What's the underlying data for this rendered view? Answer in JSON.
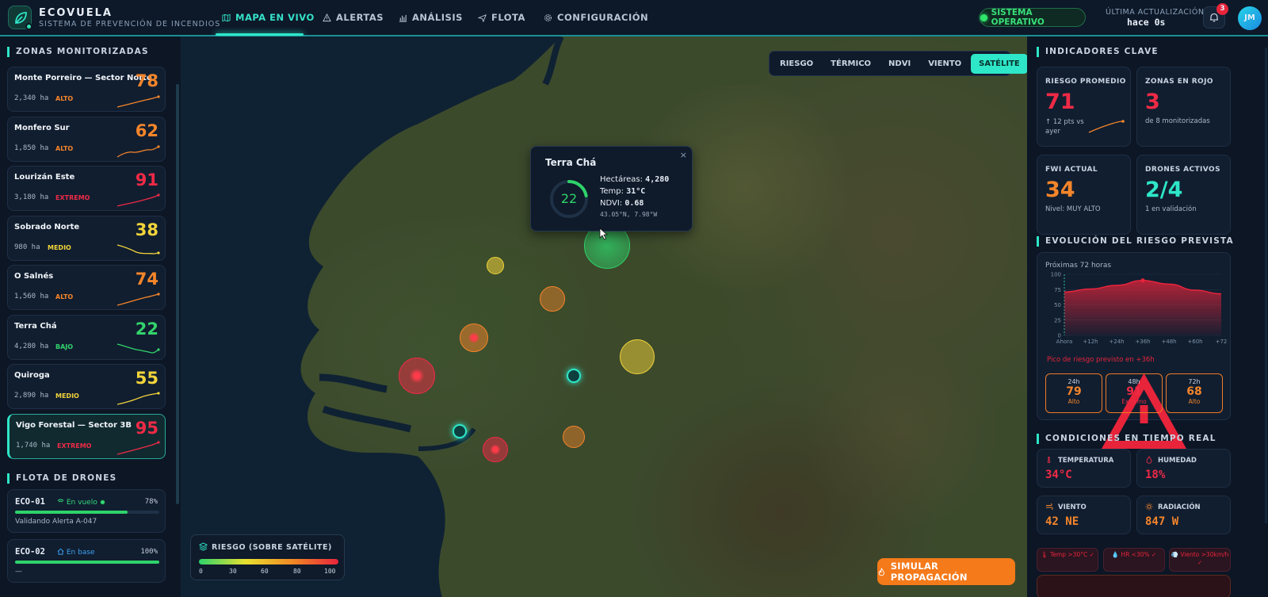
{
  "header": {
    "brand": "ECOVUELA",
    "brand_sub": "SISTEMA DE PREVENCIÓN DE INCENDIOS",
    "nav": [
      {
        "label": "MAPA EN VIVO",
        "icon": "map-icon",
        "active": true
      },
      {
        "label": "ALERTAS",
        "icon": "warning-icon",
        "active": false
      },
      {
        "label": "ANÁLISIS",
        "icon": "bar-chart-icon",
        "active": false
      },
      {
        "label": "FLOTA",
        "icon": "plane-icon",
        "active": false
      },
      {
        "label": "CONFIGURACIÓN",
        "icon": "gear-icon",
        "active": false
      }
    ],
    "status": "SISTEMA OPERATIVO",
    "update_label": "ÚLTIMA ACTUALIZACIÓN",
    "update_value": "hace 0s",
    "notifications": "3",
    "avatar": "JM"
  },
  "zones": {
    "title": "ZONAS MONITORIZADAS",
    "items": [
      {
        "name": "Monte Porreiro — Sector Norte",
        "ha": "2,340 ha",
        "level": "ALTO",
        "score": "78",
        "color": "#f5852a"
      },
      {
        "name": "Monfero Sur",
        "ha": "1,850 ha",
        "level": "ALTO",
        "score": "62",
        "color": "#f5852a"
      },
      {
        "name": "Lourizán Este",
        "ha": "3,180 ha",
        "level": "EXTREMO",
        "score": "91",
        "color": "#ee2a46"
      },
      {
        "name": "Sobrado Norte",
        "ha": "980 ha",
        "level": "MEDIO",
        "score": "38",
        "color": "#f2d43a"
      },
      {
        "name": "O Salnés",
        "ha": "1,560 ha",
        "level": "ALTO",
        "score": "74",
        "color": "#f5852a"
      },
      {
        "name": "Terra Chá",
        "ha": "4,280 ha",
        "level": "BAJO",
        "score": "22",
        "color": "#33d36b"
      },
      {
        "name": "Quiroga",
        "ha": "2,890 ha",
        "level": "MEDIO",
        "score": "55",
        "color": "#f2d43a"
      },
      {
        "name": "Vigo Forestal — Sector 3B",
        "ha": "1,740 ha",
        "level": "EXTREMO",
        "score": "95",
        "color": "#ee2a46"
      }
    ]
  },
  "fleet": {
    "title": "FLOTA DE DRONES",
    "items": [
      {
        "id": "ECO-01",
        "status": "En vuelo",
        "battery": "78%",
        "battery_level": 0.78,
        "task": "Validando Alerta A-047"
      },
      {
        "id": "ECO-02",
        "status": "En base",
        "battery": "100%",
        "battery_level": 1.0,
        "task": "—"
      }
    ]
  },
  "map": {
    "layers": [
      "RIESGO",
      "TÉRMICO",
      "NDVI",
      "VIENTO",
      "SATÉLITE"
    ],
    "active_layer": "SATÉLITE",
    "popup": {
      "title": "Terra Chá",
      "score": "22",
      "score_fraction": 0.22,
      "hectares_label": "Hectáreas:",
      "hectares": "4,280",
      "temp_label": "Temp:",
      "temp": "31°C",
      "ndvi_label": "NDVI:",
      "ndvi": "0.68",
      "coords": "43.05°N, 7.98°W",
      "close": "×"
    },
    "legend": {
      "title": "RIESGO (SOBRE SATÉLITE)",
      "ticks": [
        "0",
        "30",
        "60",
        "80",
        "100"
      ]
    },
    "simulate": "SIMULAR PROPAGACIÓN"
  },
  "kpis": {
    "title": "INDICADORES CLAVE",
    "items": [
      {
        "label": "RIESGO PROMEDIO",
        "value": "71",
        "sub": "↑ 12 pts vs ayer",
        "color": "#ee2a46"
      },
      {
        "label": "ZONAS EN ROJO",
        "value": "3",
        "sub": "de 8 monitorizadas",
        "color": "#ee2a46"
      },
      {
        "label": "FWI ACTUAL",
        "value": "34",
        "sub": "Nivel: MUY ALTO",
        "color": "#f5852a"
      },
      {
        "label": "DRONES ACTIVOS",
        "value": "2/4",
        "sub": "1 en validación",
        "color": "#2ee6c8"
      }
    ]
  },
  "forecast": {
    "title": "EVOLUCIÓN DEL RIESGO PREVISTA",
    "subtitle": "Próximas 72 horas",
    "peak": "Pico de riesgo previsto en +36h",
    "cards": [
      {
        "h": "24h",
        "v": "79",
        "l": "Alto",
        "color": "#f5852a"
      },
      {
        "h": "48h",
        "v": "91",
        "l": "Extremo",
        "color": "#ee2a46"
      },
      {
        "h": "72h",
        "v": "68",
        "l": "Alto",
        "color": "#f5852a"
      }
    ]
  },
  "chart_data": {
    "type": "area",
    "x": [
      "Ahora",
      "+12h",
      "+24h",
      "+36h",
      "+48h",
      "+60h",
      "+72"
    ],
    "values": [
      71,
      76,
      82,
      90,
      84,
      74,
      68
    ],
    "ylim": [
      0,
      100
    ],
    "yticks": [
      "0",
      "25",
      "50",
      "75",
      "100"
    ],
    "color": "#e8243b"
  },
  "conditions": {
    "title": "CONDICIONES EN TIEMPO REAL",
    "items": [
      {
        "label": "TEMPERATURA",
        "value": "34°C",
        "color": "#ee2a46",
        "icon": "thermometer-icon"
      },
      {
        "label": "HUMEDAD",
        "value": "18%",
        "color": "#ee2a46",
        "icon": "droplet-icon"
      },
      {
        "label": "VIENTO",
        "value": "42 NE",
        "color": "#f5852a",
        "icon": "wind-icon"
      },
      {
        "label": "RADIACIÓN",
        "value": "847 W",
        "color": "#f5852a",
        "icon": "sun-icon"
      }
    ],
    "chips": [
      "🌡 Temp >30°C ✓",
      "💧 HR <30% ✓",
      "💨 Viento >30km/h ✓"
    ]
  }
}
